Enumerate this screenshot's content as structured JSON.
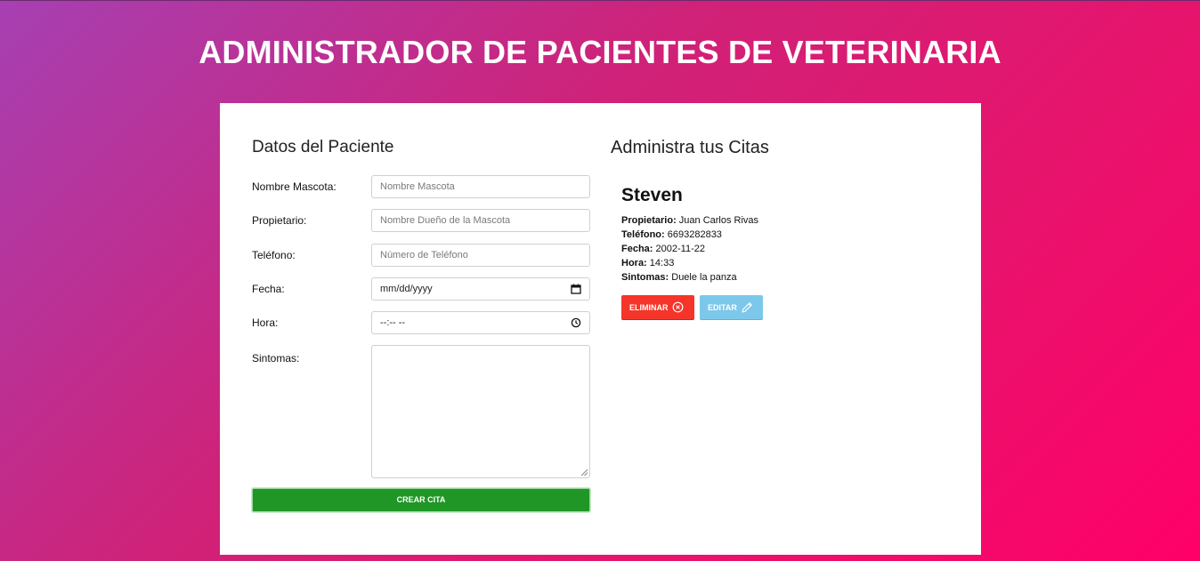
{
  "header": {
    "title": "ADMINISTRADOR DE PACIENTES DE VETERINARIA"
  },
  "form": {
    "title": "Datos del Paciente",
    "fields": [
      {
        "label": "Nombre Mascota:",
        "placeholder": "Nombre Mascota",
        "value": ""
      },
      {
        "label": "Propietario:",
        "placeholder": "Nombre Dueño de la Mascota",
        "value": ""
      },
      {
        "label": "Teléfono:",
        "placeholder": "Número de Teléfono",
        "value": ""
      },
      {
        "label": "Fecha:",
        "display": "mm/dd/yyyy",
        "icon": "calendar-icon"
      },
      {
        "label": "Hora:",
        "display": "--:-- --",
        "icon": "clock-icon"
      },
      {
        "label": "Sintomas:",
        "value": ""
      }
    ],
    "submit_label": "CREAR CITA"
  },
  "appointments": {
    "title": "Administra tus Citas",
    "items": [
      {
        "name": "Steven",
        "owner_label": "Propietario:",
        "owner": "Juan Carlos Rivas",
        "phone_label": "Teléfono:",
        "phone": "6693282833",
        "date_label": "Fecha:",
        "date": "2002-11-22",
        "time_label": "Hora:",
        "time": "14:33",
        "symptoms_label": "Sintomas:",
        "symptoms": "Duele la panza",
        "delete_label": "ELIMINAR",
        "edit_label": "EDITAR"
      }
    ]
  },
  "colors": {
    "submit": "#1f9625",
    "delete": "#f5352a",
    "edit": "#7cc8ea"
  }
}
